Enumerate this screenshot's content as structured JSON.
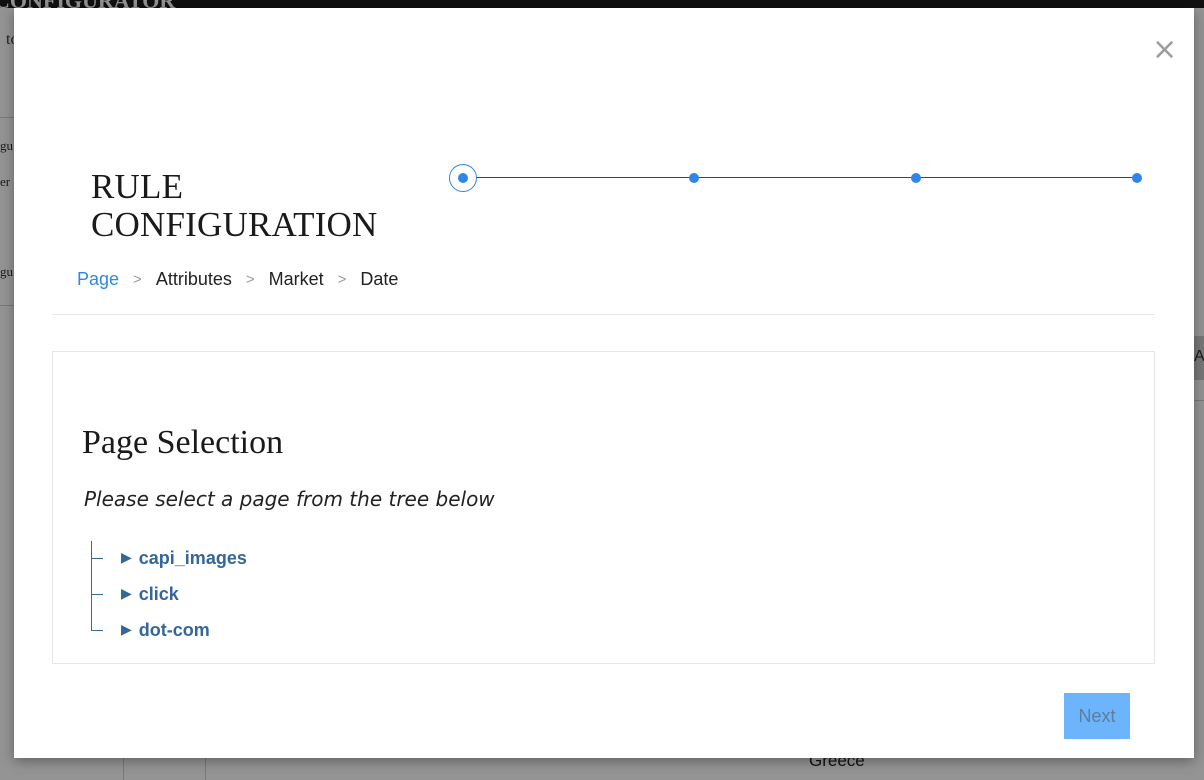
{
  "background": {
    "app_title": "CONFIGURATOR",
    "fragments": [
      "to",
      "gu",
      "er",
      "gu"
    ],
    "right_button_text": "Ap",
    "footer_text": "Greece"
  },
  "modal": {
    "close_label": "×",
    "title": "RULE CONFIGURATION",
    "stepper": {
      "steps": 4,
      "active_index": 0
    },
    "breadcrumb": [
      "Page",
      "Attributes",
      "Market",
      "Date"
    ],
    "panel": {
      "title": "Page Selection",
      "subtitle": "Please select a page from the tree below",
      "tree": [
        {
          "label": "capi_images",
          "arrow": "▶"
        },
        {
          "label": "click",
          "arrow": "▶"
        },
        {
          "label": "dot-com",
          "arrow": "▶"
        }
      ]
    },
    "next_label": "Next"
  },
  "colors": {
    "accent": "#2f86e8",
    "tree_link": "#35669a",
    "next_button_bg": "#6cb4fb"
  }
}
